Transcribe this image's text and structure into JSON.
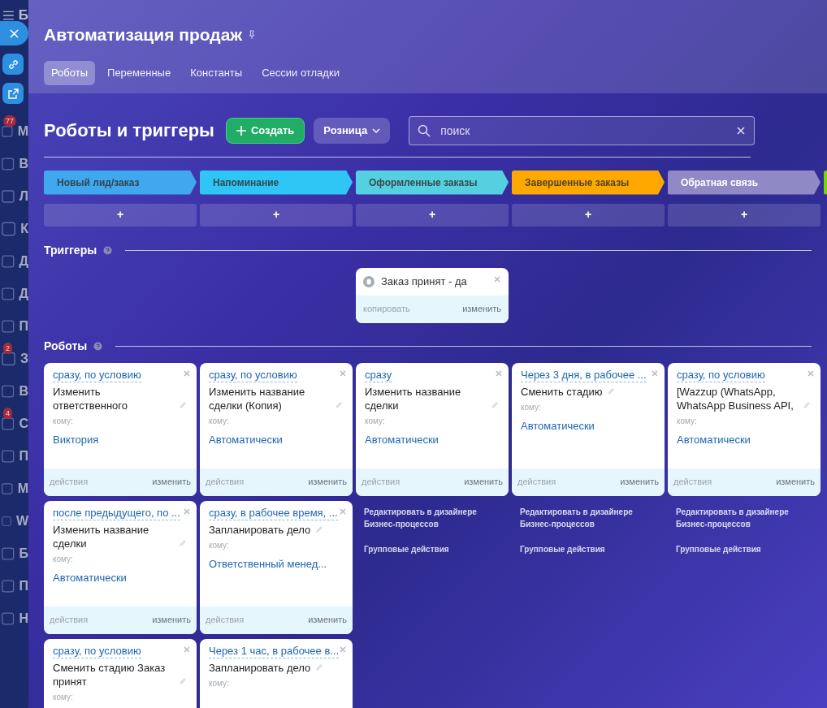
{
  "sidebar": {
    "header": "Б",
    "items": [
      {
        "label": "М",
        "badge": "77"
      },
      {
        "label": "В"
      },
      {
        "label": "Л"
      },
      {
        "label": "К"
      },
      {
        "label": "Д"
      },
      {
        "label": "Д"
      },
      {
        "label": "П"
      },
      {
        "label": "З",
        "badge": "2"
      },
      {
        "label": "В"
      },
      {
        "label": "С",
        "badge": "4"
      },
      {
        "label": "П"
      },
      {
        "label": "М"
      },
      {
        "label": "W"
      },
      {
        "label": "Б"
      },
      {
        "label": "П"
      },
      {
        "label": "Н"
      }
    ]
  },
  "panel_buttons": [
    {
      "kind": "close"
    },
    {
      "kind": "link"
    },
    {
      "kind": "external"
    }
  ],
  "window": {
    "title": "Автоматизация продаж"
  },
  "tabs": [
    {
      "label": "Роботы",
      "selected": true
    },
    {
      "label": "Переменные",
      "selected": false
    },
    {
      "label": "Константы",
      "selected": false
    },
    {
      "label": "Сессии отладки",
      "selected": false
    }
  ],
  "toolbar": {
    "heading": "Роботы и триггеры",
    "create_button": "Создать",
    "pipeline_button": "Розница",
    "search": {
      "placeholder": "поиск"
    }
  },
  "stages": [
    {
      "name": "Новый лид/заказ",
      "color": "#3fa8ef"
    },
    {
      "name": "Напоминание",
      "color": "#2fc6f6"
    },
    {
      "name": "Оформленные заказы",
      "color": "#55d0e0"
    },
    {
      "name": "Завершенные заказы",
      "color": "#ffa900"
    },
    {
      "name": "Обратная связь",
      "color": "#8f8ac6"
    },
    {
      "color": "#7bd500"
    }
  ],
  "add_buttons": [
    "+",
    "+",
    "+",
    "+",
    "+"
  ],
  "triggers_section": {
    "heading": "Триггеры",
    "columns": [
      [],
      [],
      [
        {
          "title": "Заказ принят - да",
          "copy_label": "копировать",
          "edit_label": "изменить"
        }
      ],
      [],
      []
    ]
  },
  "robots_section": {
    "heading": "Роботы",
    "columns": [
      {
        "robots": [
          {
            "condition": "сразу, по условию",
            "title": "Изменить ответственного",
            "to_label": "кому:",
            "assignee": "Виктория",
            "actions_label": "действия",
            "edit_label": "изменить"
          },
          {
            "condition": "после предыдущего, по ...",
            "title": "Изменить название сделки",
            "to_label": "кому:",
            "assignee": "Автоматически",
            "actions_label": "действия",
            "edit_label": "изменить"
          },
          {
            "condition": "сразу, по условию",
            "title": "Сменить стадию Заказ принят",
            "to_label": "кому:"
          }
        ]
      },
      {
        "robots": [
          {
            "condition": "сразу, по условию",
            "title": "Изменить название сделки (Копия)",
            "to_label": "кому:",
            "assignee": "Автоматически",
            "actions_label": "действия",
            "edit_label": "изменить"
          },
          {
            "condition": "сразу, в рабочее время, ...",
            "title": "Запланировать дело",
            "to_label": "кому:",
            "assignee": "Ответственный менед...",
            "actions_label": "действия",
            "edit_label": "изменить"
          },
          {
            "condition": "Через 1 час, в рабочее в...",
            "title": "Запланировать дело",
            "to_label": "кому:"
          }
        ]
      },
      {
        "robots": [
          {
            "condition": "сразу",
            "title": "Изменить название сделки",
            "to_label": "кому:",
            "assignee": "Автоматически",
            "actions_label": "действия",
            "edit_label": "изменить"
          }
        ],
        "links": [
          "Редактировать в дизайнере Бизнес-процессов",
          "Групповые действия"
        ]
      },
      {
        "robots": [
          {
            "condition": "Через 3 дня, в рабочее ...",
            "title": "Сменить стадию",
            "to_label": "кому:",
            "assignee": "Автоматически",
            "actions_label": "действия",
            "edit_label": "изменить"
          }
        ],
        "links": [
          "Редактировать в дизайнере Бизнес-процессов",
          "Групповые действия"
        ]
      },
      {
        "robots": [
          {
            "condition": "сразу, по условию",
            "title": "[Wazzup (WhatsApp, WhatsApp Business API,",
            "to_label": "кому:",
            "assignee": "Автоматически",
            "actions_label": "действия",
            "edit_label": "изменить"
          }
        ],
        "links": [
          "Редактировать в дизайнере Бизнес-процессов",
          "Групповые действия"
        ]
      }
    ]
  }
}
